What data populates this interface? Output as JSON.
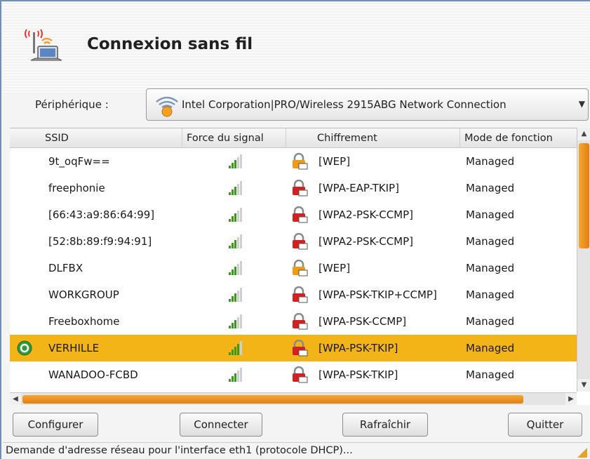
{
  "window": {
    "title": "Connexion sans fil"
  },
  "device": {
    "label": "Périphérique :",
    "value": "Intel Corporation|PRO/Wireless 2915ABG Network Connection"
  },
  "table": {
    "columns": [
      "SSID",
      "Force du signal",
      "Chiffrement",
      "Mode de fonction"
    ],
    "rows": [
      {
        "ssid": "9t_oqFw==",
        "signal": 3,
        "lock": "orange",
        "encryption": "[WEP]",
        "mode": "Managed"
      },
      {
        "ssid": "freephonie",
        "signal": 3,
        "lock": "red",
        "encryption": "[WPA-EAP-TKIP]",
        "mode": "Managed"
      },
      {
        "ssid": "[66:43:a9:86:64:99]",
        "signal": 3,
        "lock": "red",
        "encryption": "[WPA2-PSK-CCMP]",
        "mode": "Managed"
      },
      {
        "ssid": "[52:8b:89:f9:94:91]",
        "signal": 3,
        "lock": "red",
        "encryption": "[WPA2-PSK-CCMP]",
        "mode": "Managed"
      },
      {
        "ssid": "DLFBX",
        "signal": 3,
        "lock": "orange",
        "encryption": "[WEP]",
        "mode": "Managed"
      },
      {
        "ssid": "WORKGROUP",
        "signal": 3,
        "lock": "red",
        "encryption": "[WPA-PSK-TKIP+CCMP]",
        "mode": "Managed"
      },
      {
        "ssid": "Freeboxhome",
        "signal": 3,
        "lock": "red",
        "encryption": "[WPA-PSK-CCMP]",
        "mode": "Managed"
      },
      {
        "ssid": "VERHILLE",
        "signal": 4,
        "lock": "red",
        "encryption": "[WPA-PSK-TKIP]",
        "mode": "Managed",
        "selected": true
      },
      {
        "ssid": "WANADOO-FCBD",
        "signal": 3,
        "lock": "red",
        "encryption": "[WPA-PSK-TKIP]",
        "mode": "Managed"
      }
    ]
  },
  "buttons": {
    "configure": "Configurer",
    "connect": "Connecter",
    "refresh": "Rafraîchir",
    "quit": "Quitter"
  },
  "status": "Demande d'adresse réseau pour l'interface eth1 (protocole DHCP)...",
  "colors": {
    "accent": "#f2b416",
    "scroll": "#e8891a",
    "lock_red": "#d42020",
    "lock_orange": "#f09a18",
    "signal": "#3a9a1e"
  }
}
